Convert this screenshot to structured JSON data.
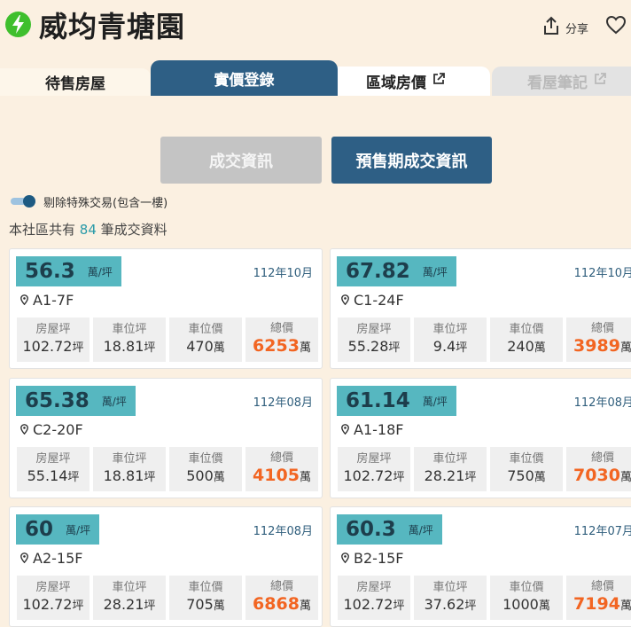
{
  "header": {
    "title": "威均青塘園",
    "share_label": "分享"
  },
  "tabs": [
    {
      "label": "待售房屋"
    },
    {
      "label": "實價登錄"
    },
    {
      "label": "區域房價"
    },
    {
      "label": "看屋筆記"
    }
  ],
  "sub_tabs": [
    "成交資訊",
    "預售期成交資訊"
  ],
  "toggle": {
    "label": "剔除特殊交易(包含一樓)",
    "on": true
  },
  "count": {
    "prefix": "本社區共有",
    "value": "84",
    "suffix": "筆成交資料"
  },
  "labels": {
    "area": "房屋坪",
    "parking_area": "車位坪",
    "parking_price": "車位價",
    "total": "總價",
    "per_ping": "萬/坪",
    "ping": "坪",
    "wan": "萬"
  },
  "cards": [
    {
      "price": "56.3",
      "date": "112年10月",
      "unit": "A1-7F",
      "area": "102.72",
      "parking_area": "18.81",
      "parking_price": "470",
      "total": "6253"
    },
    {
      "price": "67.82",
      "date": "112年10月",
      "unit": "C1-24F",
      "area": "55.28",
      "parking_area": "9.4",
      "parking_price": "240",
      "total": "3989"
    },
    {
      "price": "65.38",
      "date": "112年08月",
      "unit": "C2-20F",
      "area": "55.14",
      "parking_area": "18.81",
      "parking_price": "500",
      "total": "4105"
    },
    {
      "price": "61.14",
      "date": "112年08月",
      "unit": "A1-18F",
      "area": "102.72",
      "parking_area": "28.21",
      "parking_price": "750",
      "total": "7030"
    },
    {
      "price": "60",
      "date": "112年08月",
      "unit": "A2-15F",
      "area": "102.72",
      "parking_area": "28.21",
      "parking_price": "705",
      "total": "6868"
    },
    {
      "price": "60.3",
      "date": "112年07月",
      "unit": "B2-15F",
      "area": "102.72",
      "parking_area": "37.62",
      "parking_price": "1000",
      "total": "7194"
    }
  ],
  "colors": {
    "accent": "#2e5f85",
    "badge": "#56b7c0",
    "total": "#f26522",
    "background": "#fbf0e1"
  }
}
